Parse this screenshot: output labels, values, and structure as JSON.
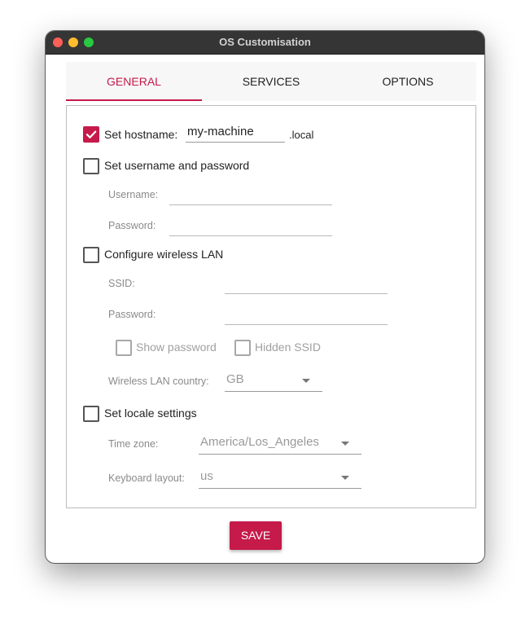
{
  "window": {
    "title": "OS Customisation"
  },
  "tabs": [
    {
      "label": "GENERAL",
      "active": true
    },
    {
      "label": "SERVICES",
      "active": false
    },
    {
      "label": "OPTIONS",
      "active": false
    }
  ],
  "general": {
    "hostname": {
      "label": "Set hostname:",
      "value": "my-machine",
      "suffix": ".local",
      "checked": true
    },
    "user": {
      "label": "Set username and password",
      "checked": false,
      "username_label": "Username:",
      "username_value": "",
      "password_label": "Password:",
      "password_value": ""
    },
    "wifi": {
      "label": "Configure wireless LAN",
      "checked": false,
      "ssid_label": "SSID:",
      "ssid_value": "",
      "password_label": "Password:",
      "password_value": "",
      "show_password_label": "Show password",
      "show_password_checked": false,
      "hidden_ssid_label": "Hidden SSID",
      "hidden_ssid_checked": false,
      "country_label": "Wireless LAN country:",
      "country_value": "GB"
    },
    "locale": {
      "label": "Set locale settings",
      "checked": false,
      "timezone_label": "Time zone:",
      "timezone_value": "America/Los_Angeles",
      "keyboard_label": "Keyboard layout:",
      "keyboard_value": "us"
    }
  },
  "save_label": "SAVE",
  "colors": {
    "accent": "#c51a4a",
    "titlebar": "#353535",
    "tabbar": "#f7f7f7"
  }
}
